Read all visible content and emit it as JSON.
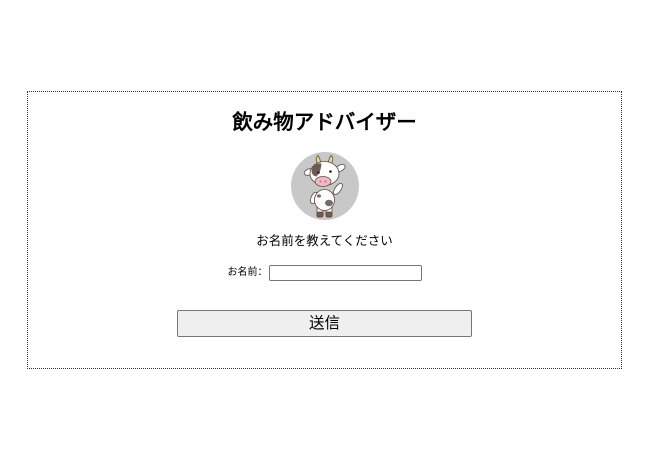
{
  "app": {
    "title": "飲み物アドバイザー",
    "prompt": "お名前を教えてください"
  },
  "avatar": {
    "icon": "cow-icon"
  },
  "form": {
    "name_label": "お名前：",
    "name_value": "",
    "submit_label": "送信"
  },
  "colors": {
    "avatar_bg": "#c8c8c8",
    "button_bg": "#efefef",
    "control_border": "#767676",
    "card_border": "#333333"
  }
}
